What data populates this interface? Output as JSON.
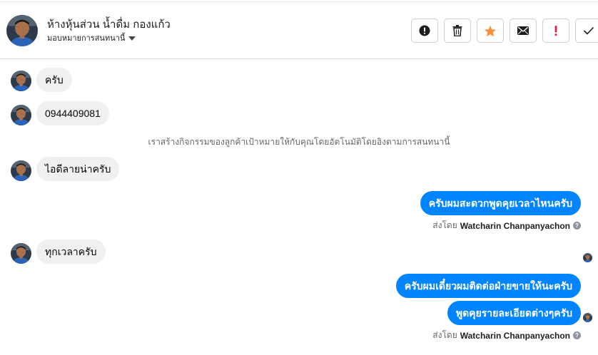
{
  "header": {
    "contact_name": "ห้างหุ้นส่วน น้ำดื่ม กองแก้ว",
    "assign_label": "มอบหมายการสนทนานี้",
    "actions": [
      {
        "icon": "alert-circle-icon"
      },
      {
        "icon": "trash-icon"
      },
      {
        "icon": "star-icon"
      },
      {
        "icon": "envelope-icon"
      },
      {
        "icon": "exclamation-icon"
      },
      {
        "icon": "check-icon"
      }
    ]
  },
  "messages": {
    "m1": "ครับ",
    "m2": "0944409081",
    "system_note": "เราสร้างกิจกรรมของลูกค้าเป้าหมายให้กับคุณโดยอัตโนมัติโดยอิงตามการสนทนานี้",
    "m3": "ไอดีลายน่าครับ",
    "m4": "ครับผมสะดวกพูดคุยเวลาไหนครับ",
    "sent_by_1_prefix": "ส่งโดย",
    "sent_by_1_name": "Watcharin Chanpanyachon",
    "m5": "ทุกเวลาครับ",
    "m6": "ครับผมเดี๋ยวผมติดต่อฝ่ายขายให้นะครับ",
    "m7": "พูดคุยรายละเอียดต่างๆครับ",
    "sent_by_2_prefix": "ส่งโดย",
    "sent_by_2_name": "Watcharin Chanpanyachon",
    "help_glyph": "?"
  },
  "colors": {
    "outgoing_bubble": "#0084ff",
    "incoming_bubble": "#f0f0f0",
    "star": "#f7923a",
    "alert_red": "#e41e3f"
  }
}
